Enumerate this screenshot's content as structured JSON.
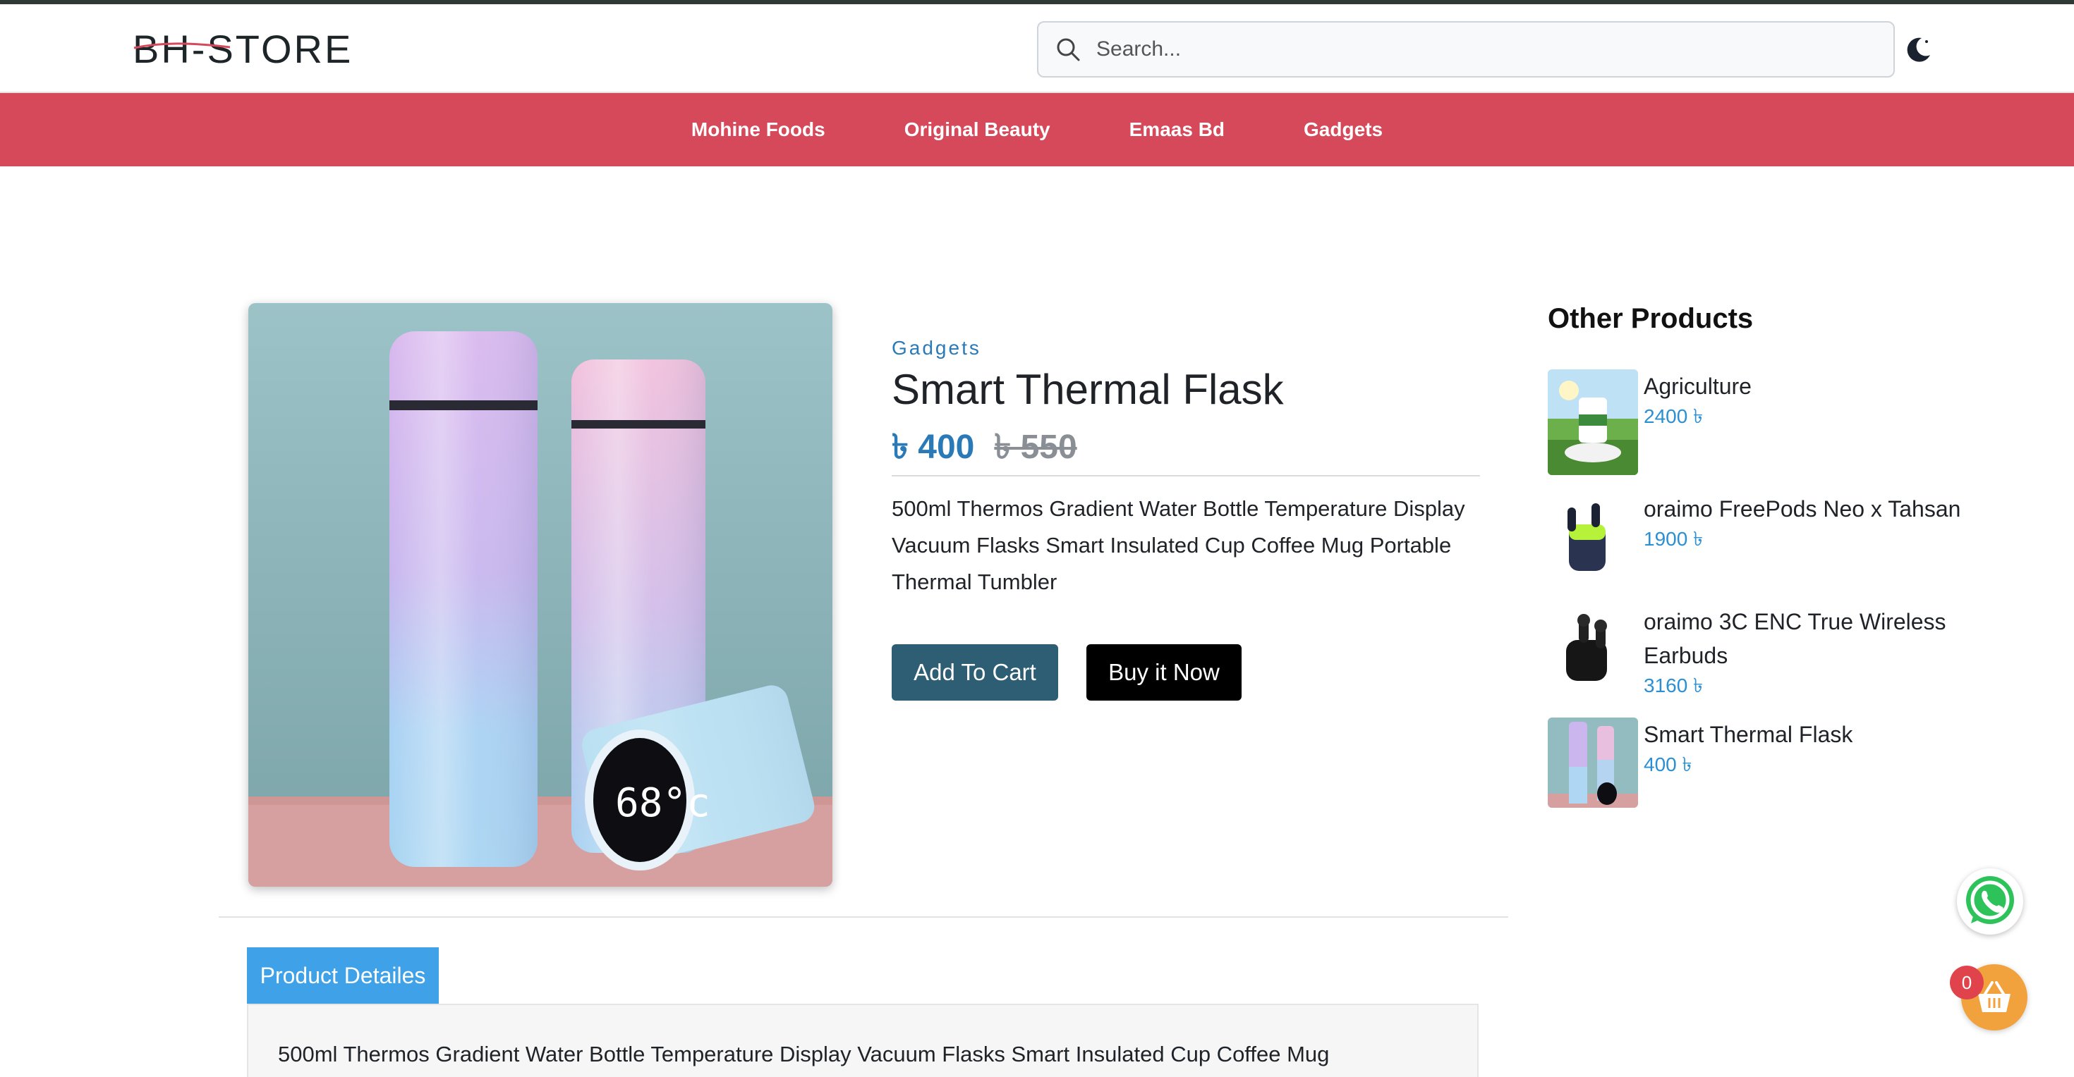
{
  "brand": {
    "logo_text": "BH-STORE"
  },
  "search": {
    "placeholder": "Search..."
  },
  "nav": {
    "items": [
      "Mohine Foods",
      "Original Beauty",
      "Emaas Bd",
      "Gadgets"
    ]
  },
  "product": {
    "category": "Gadgets",
    "title": "Smart Thermal Flask",
    "price": "৳ 400",
    "old_price": "৳ 550",
    "description": "500ml Thermos Gradient Water Bottle Temperature Display Vacuum Flasks Smart Insulated Cup Coffee Mug Portable Thermal Tumbler",
    "image_display_text": "68°c",
    "add_to_cart_label": "Add To Cart",
    "buy_now_label": "Buy it Now"
  },
  "other_products": {
    "title": "Other Products",
    "items": [
      {
        "name": "Agriculture",
        "price": "2400 ৳"
      },
      {
        "name": "oraimo FreePods Neo x Tahsan",
        "price": "1900 ৳"
      },
      {
        "name": "oraimo 3C ENC True Wireless Earbuds",
        "price": "3160 ৳"
      },
      {
        "name": "Smart Thermal Flask",
        "price": "400 ৳"
      }
    ]
  },
  "tabs": {
    "details_label": "Product Detailes",
    "details_text": "500ml Thermos Gradient Water Bottle Temperature Display Vacuum Flasks Smart Insulated Cup Coffee Mug"
  },
  "cart": {
    "count": "0"
  },
  "colors": {
    "nav_bg": "#d6495b",
    "accent_blue": "#2b7ab8",
    "cart_button": "#2d5e73",
    "buy_button": "#000000",
    "tab_active": "#3fa1e8",
    "cart_fab": "#f2a23c",
    "badge": "#e0434b"
  },
  "icons": [
    "search-icon",
    "moon-icon",
    "whatsapp-icon",
    "basket-icon"
  ]
}
